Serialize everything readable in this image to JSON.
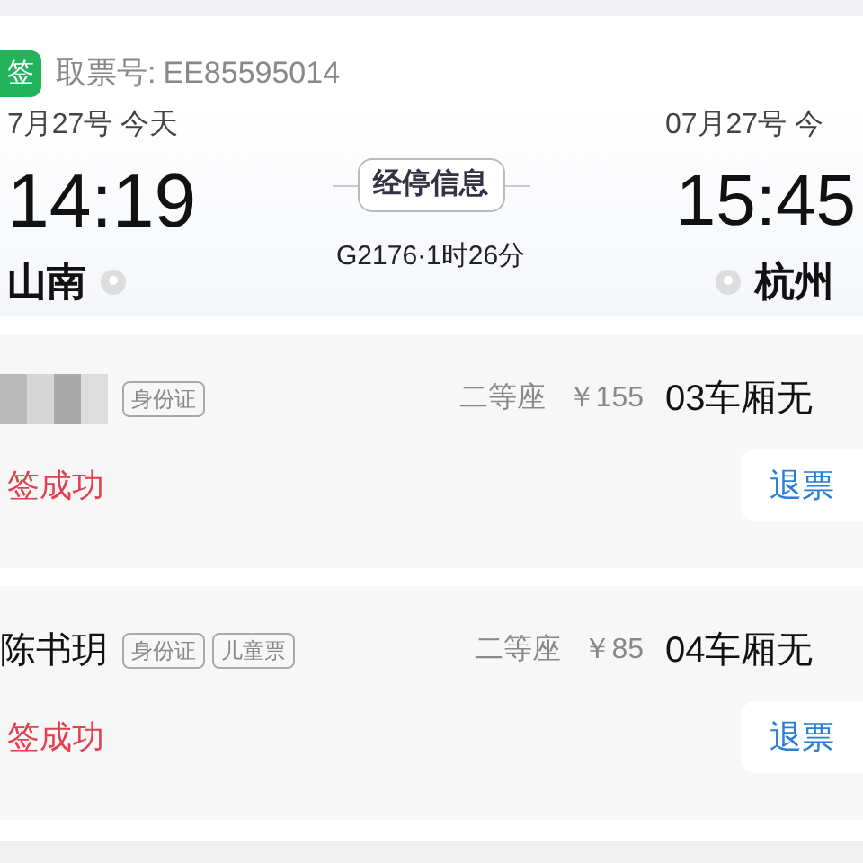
{
  "order": {
    "badge": "签",
    "pickup_label": "取票号:",
    "pickup_code": "EE85595014"
  },
  "trip": {
    "depart_date": "7月27号 今天",
    "depart_time": "14:19",
    "depart_station": "山南",
    "stops_button": "经停信息",
    "train_info": "G2176·1时26分",
    "arrive_date": "07月27号 今",
    "arrive_time": "15:45",
    "arrive_station": "杭州"
  },
  "passengers": [
    {
      "tags": [
        "身份证"
      ],
      "seat_class": "二等座",
      "price": "￥155",
      "seat": "03车厢无",
      "status": "签成功",
      "action": "退票"
    },
    {
      "name": "陈书玥",
      "tags": [
        "身份证",
        "儿童票"
      ],
      "seat_class": "二等座",
      "price": "￥85",
      "seat": "04车厢无",
      "status": "签成功",
      "action": "退票"
    }
  ]
}
